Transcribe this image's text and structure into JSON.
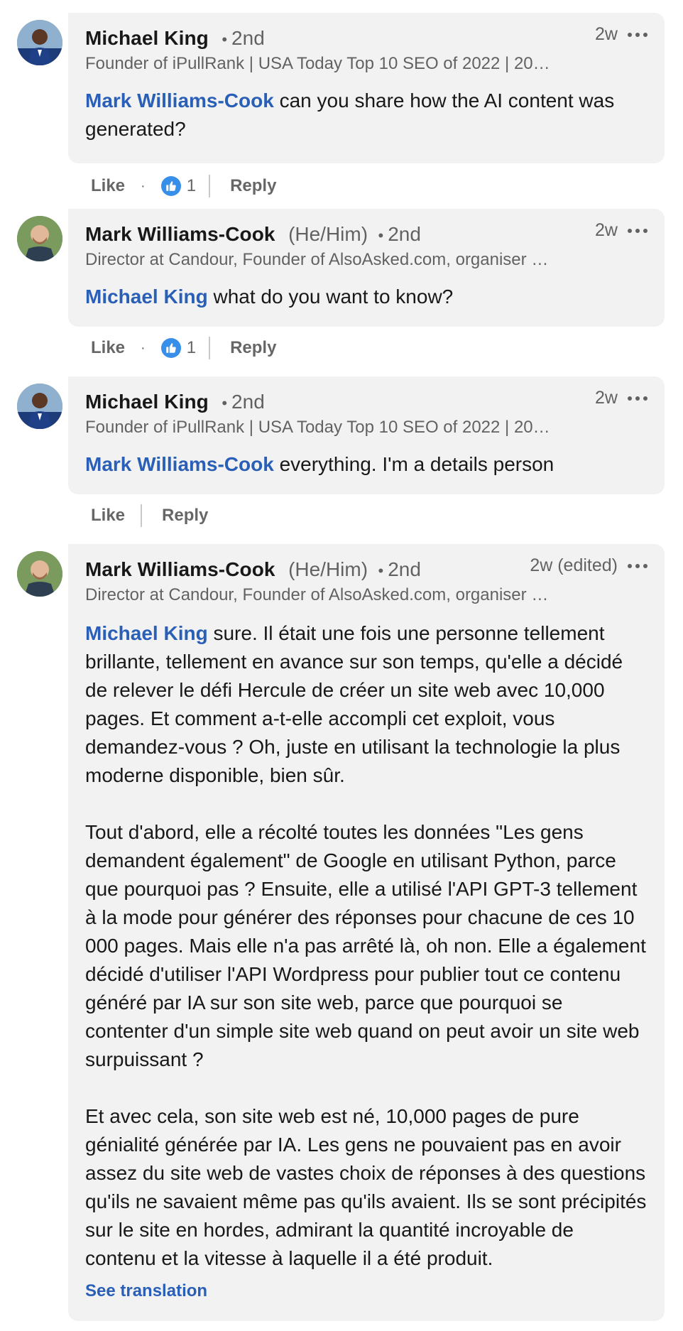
{
  "comments": [
    {
      "author": "Michael King",
      "pronouns": "",
      "degree": "2nd",
      "headline": "Founder of iPullRank | USA Today Top 10 SEO of 2022 | 20…",
      "time": "2w",
      "mention": "Mark Williams-Cook",
      "text": " can you share how the AI content was generated?",
      "like_label": "Like",
      "reaction_count": "1",
      "reply_label": "Reply"
    },
    {
      "author": "Mark Williams-Cook",
      "pronouns": "(He/Him)",
      "degree": "2nd",
      "headline": "Director at Candour, Founder of AlsoAsked.com, organiser …",
      "time": "2w",
      "mention": "Michael King",
      "text": " what do you want to know?",
      "like_label": "Like",
      "reaction_count": "1",
      "reply_label": "Reply"
    },
    {
      "author": "Michael King",
      "pronouns": "",
      "degree": "2nd",
      "headline": "Founder of iPullRank | USA Today Top 10 SEO of 2022 | 20…",
      "time": "2w",
      "mention": "Mark Williams-Cook",
      "text": " everything. I'm a details person",
      "like_label": "Like",
      "reaction_count": "",
      "reply_label": "Reply"
    },
    {
      "author": "Mark Williams-Cook",
      "pronouns": "(He/Him)",
      "degree": "2nd",
      "headline": "Director at Candour, Founder of AlsoAsked.com, organiser …",
      "time": "2w (edited)",
      "mention": "Michael King",
      "text": " sure. Il était une fois une personne tellement brillante, tellement en avance sur son temps, qu'elle a décidé de relever le défi Hercule de créer un site web avec 10,000 pages. Et comment a-t-elle accompli cet exploit, vous demandez-vous ? Oh, juste en utilisant la technologie la plus moderne disponible, bien sûr.\n\nTout d'abord, elle a récolté toutes les données \"Les gens demandent également\" de Google en utilisant Python, parce que pourquoi pas ? Ensuite, elle a utilisé l'API GPT-3 tellement à la mode pour générer des réponses pour chacune de ces 10 000 pages. Mais elle n'a pas arrêté là, oh non. Elle a également décidé d'utiliser l'API Wordpress pour publier tout ce contenu généré par IA sur son site web, parce que pourquoi se contenter d'un simple site web quand on peut avoir un site web surpuissant ?\n\nEt avec cela, son site web est né, 10,000 pages de pure génialité générée par IA. Les gens ne pouvaient pas en avoir assez du site web de vastes choix de réponses à des questions qu'ils ne savaient même pas qu'ils avaient. Ils se sont précipités sur le site en hordes, admirant la quantité incroyable de contenu et la vitesse à laquelle il a été produit.",
      "see_translation": "See translation"
    }
  ],
  "icons": {
    "more": "more-options-icon",
    "like": "thumbs-up-icon"
  },
  "colors": {
    "mention": "#2a5fb7",
    "bubble": "#f2f2f2",
    "like_badge": "#378fe9"
  }
}
